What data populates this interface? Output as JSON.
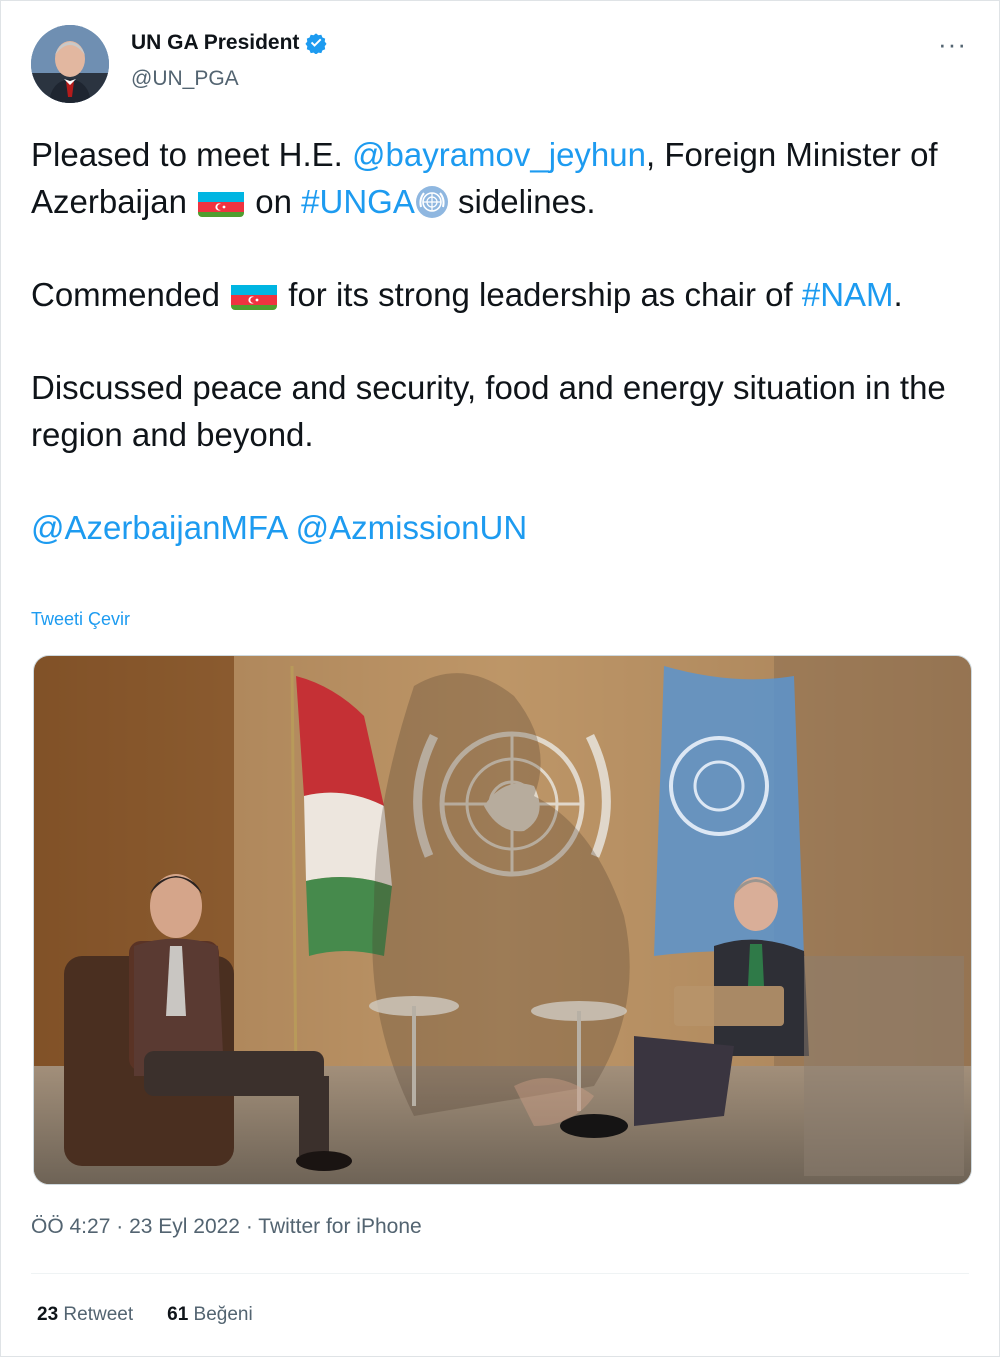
{
  "user": {
    "display_name": "UN GA President",
    "handle": "@UN_PGA",
    "verified": true,
    "avatar": "avatar-photo"
  },
  "more_icon": "more-options-icon",
  "tweet": {
    "p1": {
      "t1": "Pleased to meet H.E. ",
      "mention": "@bayramov_jeyhun",
      "t2": ", Foreign Minister of Azerbaijan ",
      "flag": "azerbaijan-flag-icon",
      "t3": " on ",
      "hashtag": "#UNGA",
      "emblem": "un-emblem-icon",
      "t4": " sidelines."
    },
    "p2": {
      "t1": "Commended ",
      "flag": "azerbaijan-flag-icon",
      "t2": " for its strong leadership as chair of ",
      "hashtag": "#NAM",
      "t3": "."
    },
    "p3": "Discussed peace and security, food and energy situation in the region and beyond.",
    "p4": {
      "mention1": "@AzerbaijanMFA",
      "mention2": "@AzmissionUN"
    }
  },
  "translate_label": "Tweeti Çevir",
  "photo_label": "tweet-photo",
  "meta": {
    "time": "ÖÖ 4:27",
    "date": "23 Eyl 2022",
    "source": "Twitter for iPhone"
  },
  "stats": {
    "retweets_count": "23",
    "retweets_label": "Retweet",
    "likes_count": "61",
    "likes_label": "Beğeni"
  },
  "colors": {
    "link": "#1d9bf0",
    "text": "#0f1419",
    "muted": "#536471"
  }
}
